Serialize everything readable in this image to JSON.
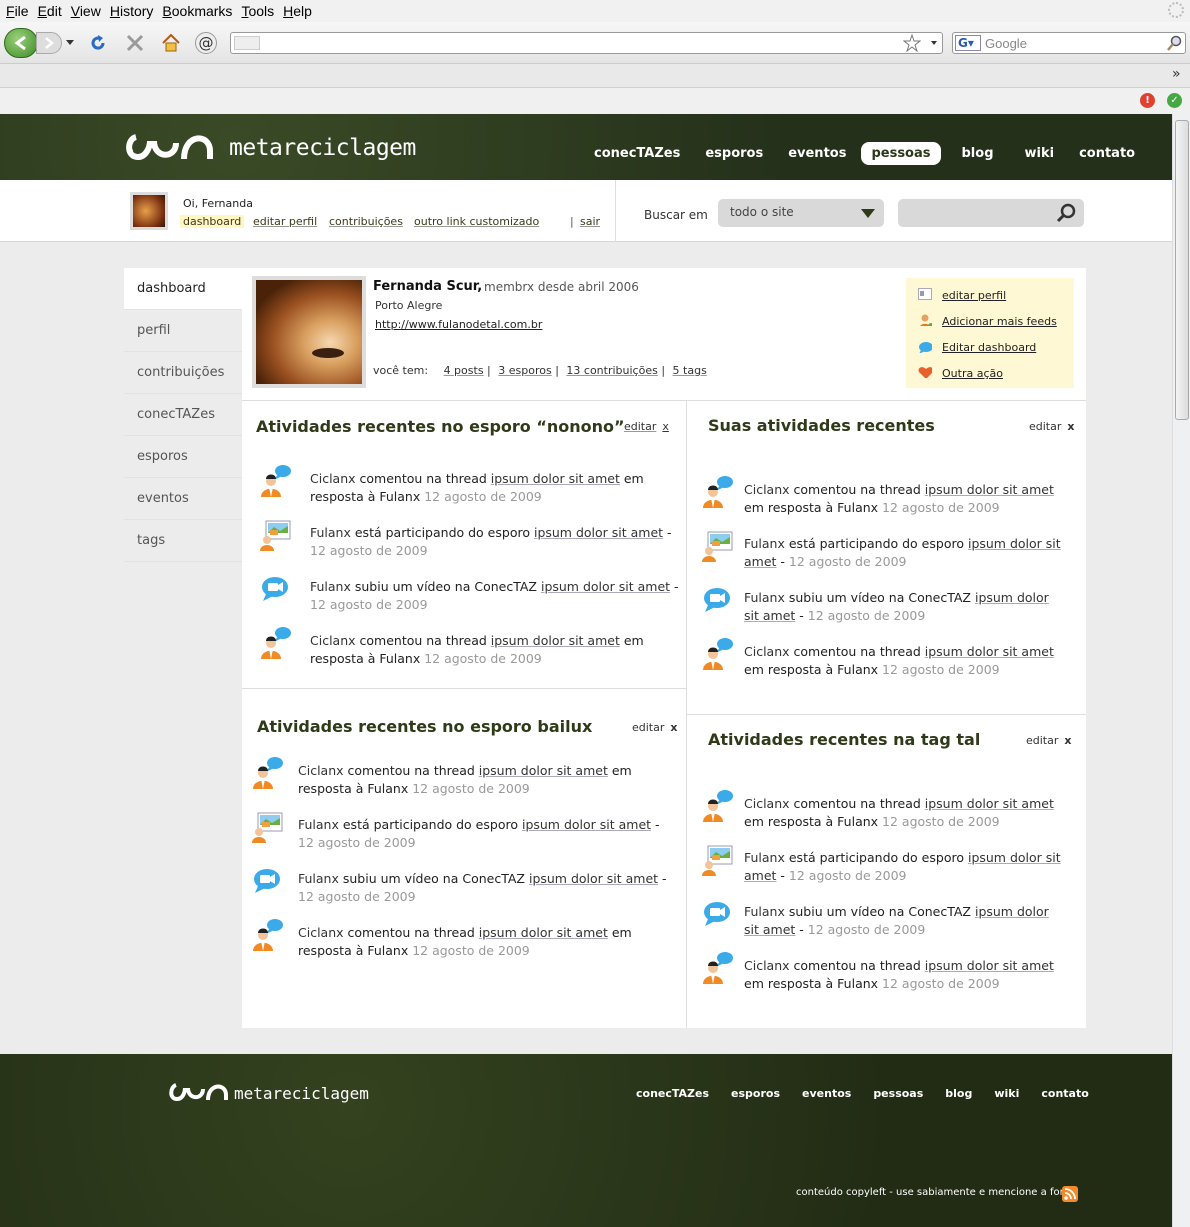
{
  "browser": {
    "menus": [
      "File",
      "Edit",
      "View",
      "History",
      "Bookmarks",
      "Tools",
      "Help"
    ],
    "search_placeholder": "Google"
  },
  "site": {
    "name": "metareciclagem",
    "nav": [
      "conecTAZes",
      "esporos",
      "eventos",
      "pessoas",
      "blog",
      "wiki",
      "contato"
    ],
    "active_nav": "pessoas"
  },
  "userbar": {
    "greeting": "Oi, Fernanda",
    "links": [
      "dashboard",
      "editar perfil",
      "contribuições",
      "outro link customizado"
    ],
    "separator": "|",
    "logout": "sair",
    "search_label": "Buscar  em",
    "scope": "todo o site"
  },
  "leftnav": [
    "dashboard",
    "perfil",
    "contribuições",
    "conecTAZes",
    "esporos",
    "eventos",
    "tags"
  ],
  "profile": {
    "name": "Fernanda Scur,",
    "since": "membrx desde abril 2006",
    "city": "Porto Alegre",
    "url": "http://www.fulanodetal.com.br",
    "stats_label": "você tem:",
    "stats": [
      "4 posts",
      "3 esporos",
      "13  contribuições",
      "5 tags"
    ]
  },
  "actions": [
    {
      "label": "editar perfil",
      "icon": "profile-card-icon"
    },
    {
      "label": "Adicionar mais feeds",
      "icon": "user-add-icon"
    },
    {
      "label": "Editar dashboard",
      "icon": "speech-bubble-icon"
    },
    {
      "label": "Outra ação",
      "icon": "heart-icon"
    }
  ],
  "panels": {
    "edit_label": "editar",
    "close_label": "x",
    "p1": {
      "title": "Atividades recentes no esporo “nonono”"
    },
    "p2": {
      "title": "Suas atividades recentes"
    },
    "p3": {
      "title": "Atividades recentes no esporo bailux"
    },
    "p4": {
      "title": "Atividades recentes na tag tal"
    }
  },
  "activity": {
    "comment": {
      "actor": "Ciclanx",
      "verb": " comentou na thread ",
      "link": "ipsum dolor sit amet",
      "tail": " em resposta à Fulanx ",
      "date": "12 agosto de 2009"
    },
    "join": {
      "actor": "Fulanx",
      "verb": " está participando do esporo ",
      "link": " ipsum dolor sit amet",
      "tail": " - ",
      "date": "12 agosto de 2009"
    },
    "video": {
      "actor": "Fulanx",
      "verb": " subiu um vídeo na ConecTAZ ",
      "link": " ipsum dolor sit amet",
      "tail": " - ",
      "date": "12 agosto de 2009"
    }
  },
  "footer": {
    "nav": [
      "conecTAZes",
      "esporos",
      "eventos",
      "pessoas",
      "blog",
      "wiki",
      "contato"
    ],
    "copyleft": "conteúdo copyleft - use sabiamente e mencione a fonte"
  }
}
